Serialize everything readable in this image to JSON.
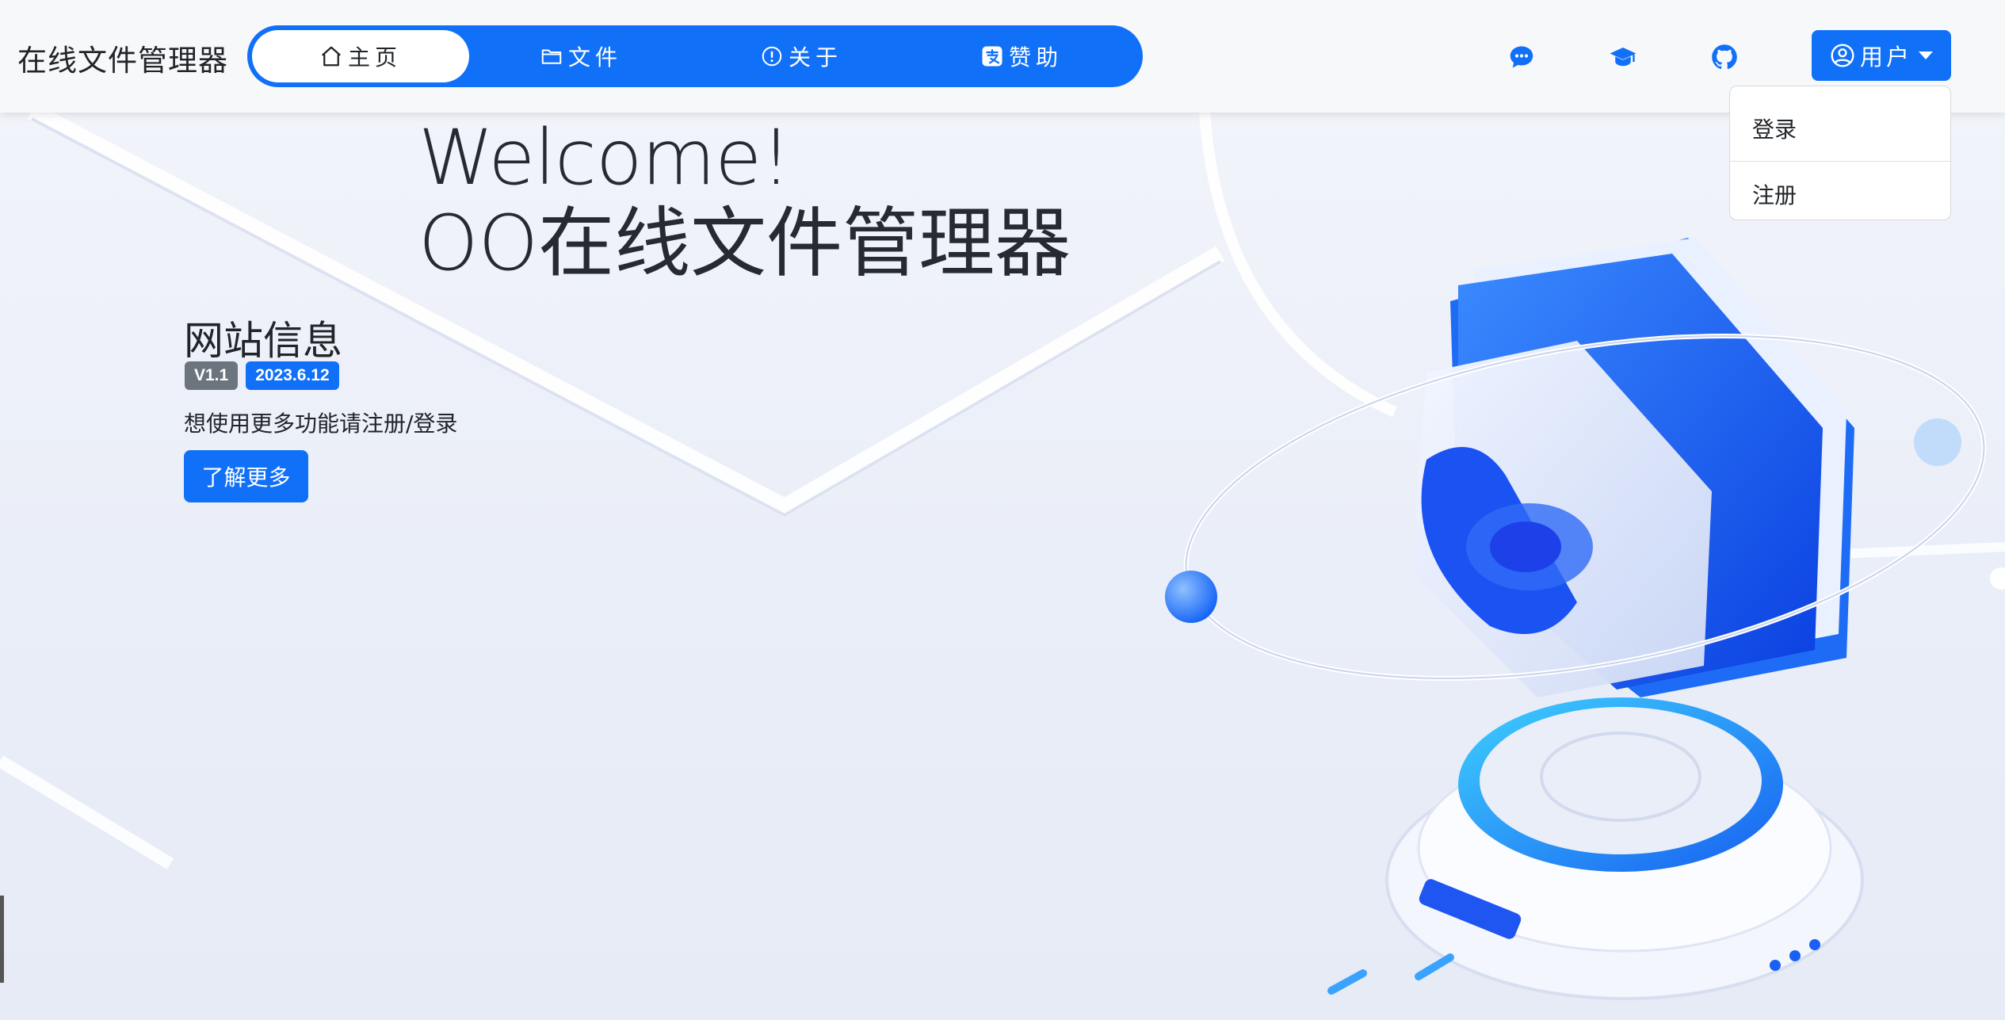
{
  "navbar": {
    "brand": "在线文件管理器",
    "tabs": [
      {
        "label": "主页",
        "icon": "home-icon",
        "active": true
      },
      {
        "label": "文件",
        "icon": "folder-icon",
        "active": false
      },
      {
        "label": "关于",
        "icon": "info-icon",
        "active": false
      },
      {
        "label": "赞助",
        "icon": "alipay-icon",
        "active": false
      }
    ],
    "icons": [
      "chat-icon",
      "graduation-cap-icon",
      "github-icon"
    ],
    "user_label": "用户"
  },
  "dropdown": {
    "items": [
      "登录",
      "注册"
    ]
  },
  "hero": {
    "welcome_line1": "Welcome!",
    "welcome_line2": "OO在线文件管理器",
    "site_info_title": "网站信息",
    "version_badge": "V1.1",
    "date_badge": "2023.6.12",
    "hint": "想使用更多功能请注册/登录",
    "learn_more": "了解更多"
  },
  "colors": {
    "accent": "#1170f8",
    "badge_grey": "#6c757d",
    "navbar_bg": "#f7f8fa"
  }
}
